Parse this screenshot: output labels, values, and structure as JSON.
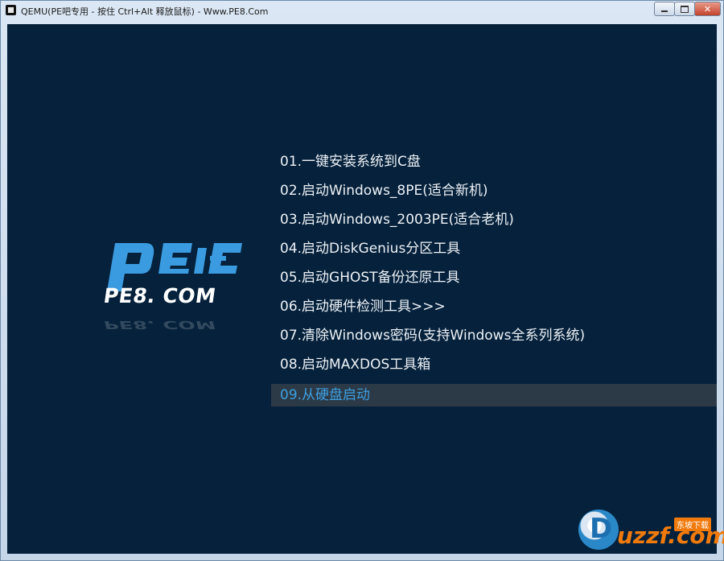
{
  "window": {
    "title": "QEMU(PE吧专用 - 按住 Ctrl+Alt 释放鼠标) - Www.PE8.Com",
    "controls": {
      "minimize": "–",
      "maximize": "□",
      "close": "✕"
    }
  },
  "logo": {
    "text": "PE8. COM",
    "icon": "pe-logo-icon"
  },
  "menu": {
    "items": [
      {
        "label": "01.一键安装系统到C盘"
      },
      {
        "label": "02.启动Windows_8PE(适合新机)"
      },
      {
        "label": "03.启动Windows_2003PE(适合老机)"
      },
      {
        "label": "04.启动DiskGenius分区工具"
      },
      {
        "label": "05.启动GHOST备份还原工具"
      },
      {
        "label": "06.启动硬件检测工具>>>"
      },
      {
        "label": "07.清除Windows密码(支持Windows全系列系统)"
      },
      {
        "label": "08.启动MAXDOS工具箱"
      },
      {
        "label": "09.从硬盘启动",
        "selected": true
      }
    ]
  },
  "watermark": {
    "letter": "D",
    "text": "uzzf.com",
    "tag": "东坡下载"
  },
  "colors": {
    "screen_bg": "#05213b",
    "logo_blue": "#3b9be0",
    "selected_text": "#3d9fe0",
    "selected_bg": "#2c3a48"
  }
}
